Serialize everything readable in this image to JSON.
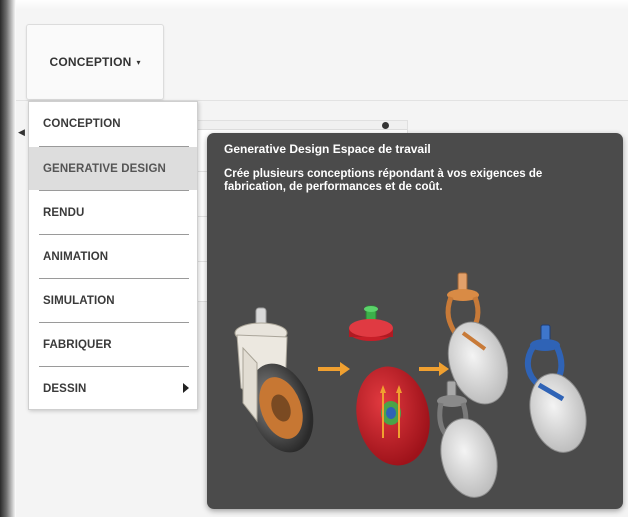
{
  "toolbar": {
    "workspace_button_label": "CONCEPTION",
    "workspace_caret": "▾"
  },
  "workspace_menu": {
    "items": [
      {
        "label": "CONCEPTION",
        "active": false
      },
      {
        "label": "GENERATIVE DESIGN",
        "active": true
      },
      {
        "label": "RENDU",
        "active": false
      },
      {
        "label": "ANIMATION",
        "active": false
      },
      {
        "label": "SIMULATION",
        "active": false
      },
      {
        "label": "FABRIQUER",
        "active": false
      },
      {
        "label": "DESSIN",
        "active": false,
        "has_submenu": true
      }
    ]
  },
  "tooltip": {
    "title": "Generative Design Espace de travail",
    "description": "Crée plusieurs conceptions répondant à vos exigences de fabrication, de performances et de coût."
  },
  "colors": {
    "tooltip_bg": "#4b4b4b",
    "arrow": "#f0a030",
    "obstacle_red": "#c81e28",
    "preserve_green": "#3cb04a",
    "result_orange": "#d98b45",
    "result_gray": "#8a8a8a",
    "result_blue": "#2f63b6"
  },
  "icons": [
    "chevron-down-icon",
    "chevron-right-icon",
    "arrow-right-icon"
  ]
}
